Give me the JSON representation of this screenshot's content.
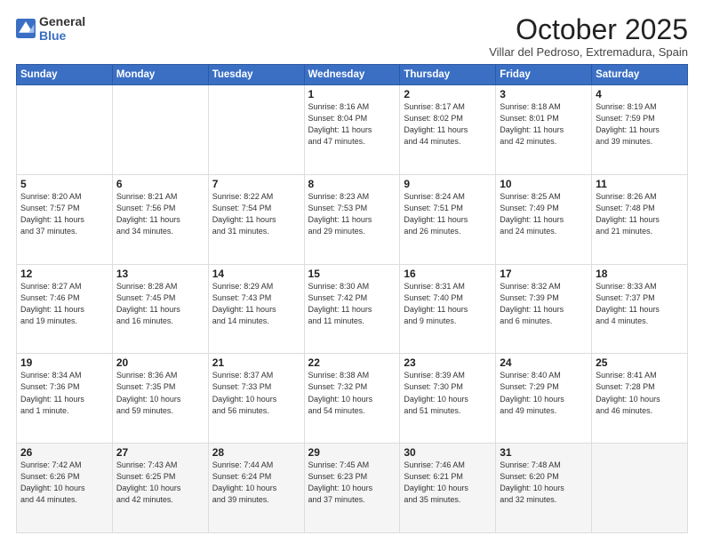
{
  "header": {
    "logo_general": "General",
    "logo_blue": "Blue",
    "month": "October 2025",
    "subtitle": "Villar del Pedroso, Extremadura, Spain"
  },
  "weekdays": [
    "Sunday",
    "Monday",
    "Tuesday",
    "Wednesday",
    "Thursday",
    "Friday",
    "Saturday"
  ],
  "weeks": [
    [
      {
        "day": "",
        "info": ""
      },
      {
        "day": "",
        "info": ""
      },
      {
        "day": "",
        "info": ""
      },
      {
        "day": "1",
        "info": "Sunrise: 8:16 AM\nSunset: 8:04 PM\nDaylight: 11 hours\nand 47 minutes."
      },
      {
        "day": "2",
        "info": "Sunrise: 8:17 AM\nSunset: 8:02 PM\nDaylight: 11 hours\nand 44 minutes."
      },
      {
        "day": "3",
        "info": "Sunrise: 8:18 AM\nSunset: 8:01 PM\nDaylight: 11 hours\nand 42 minutes."
      },
      {
        "day": "4",
        "info": "Sunrise: 8:19 AM\nSunset: 7:59 PM\nDaylight: 11 hours\nand 39 minutes."
      }
    ],
    [
      {
        "day": "5",
        "info": "Sunrise: 8:20 AM\nSunset: 7:57 PM\nDaylight: 11 hours\nand 37 minutes."
      },
      {
        "day": "6",
        "info": "Sunrise: 8:21 AM\nSunset: 7:56 PM\nDaylight: 11 hours\nand 34 minutes."
      },
      {
        "day": "7",
        "info": "Sunrise: 8:22 AM\nSunset: 7:54 PM\nDaylight: 11 hours\nand 31 minutes."
      },
      {
        "day": "8",
        "info": "Sunrise: 8:23 AM\nSunset: 7:53 PM\nDaylight: 11 hours\nand 29 minutes."
      },
      {
        "day": "9",
        "info": "Sunrise: 8:24 AM\nSunset: 7:51 PM\nDaylight: 11 hours\nand 26 minutes."
      },
      {
        "day": "10",
        "info": "Sunrise: 8:25 AM\nSunset: 7:49 PM\nDaylight: 11 hours\nand 24 minutes."
      },
      {
        "day": "11",
        "info": "Sunrise: 8:26 AM\nSunset: 7:48 PM\nDaylight: 11 hours\nand 21 minutes."
      }
    ],
    [
      {
        "day": "12",
        "info": "Sunrise: 8:27 AM\nSunset: 7:46 PM\nDaylight: 11 hours\nand 19 minutes."
      },
      {
        "day": "13",
        "info": "Sunrise: 8:28 AM\nSunset: 7:45 PM\nDaylight: 11 hours\nand 16 minutes."
      },
      {
        "day": "14",
        "info": "Sunrise: 8:29 AM\nSunset: 7:43 PM\nDaylight: 11 hours\nand 14 minutes."
      },
      {
        "day": "15",
        "info": "Sunrise: 8:30 AM\nSunset: 7:42 PM\nDaylight: 11 hours\nand 11 minutes."
      },
      {
        "day": "16",
        "info": "Sunrise: 8:31 AM\nSunset: 7:40 PM\nDaylight: 11 hours\nand 9 minutes."
      },
      {
        "day": "17",
        "info": "Sunrise: 8:32 AM\nSunset: 7:39 PM\nDaylight: 11 hours\nand 6 minutes."
      },
      {
        "day": "18",
        "info": "Sunrise: 8:33 AM\nSunset: 7:37 PM\nDaylight: 11 hours\nand 4 minutes."
      }
    ],
    [
      {
        "day": "19",
        "info": "Sunrise: 8:34 AM\nSunset: 7:36 PM\nDaylight: 11 hours\nand 1 minute."
      },
      {
        "day": "20",
        "info": "Sunrise: 8:36 AM\nSunset: 7:35 PM\nDaylight: 10 hours\nand 59 minutes."
      },
      {
        "day": "21",
        "info": "Sunrise: 8:37 AM\nSunset: 7:33 PM\nDaylight: 10 hours\nand 56 minutes."
      },
      {
        "day": "22",
        "info": "Sunrise: 8:38 AM\nSunset: 7:32 PM\nDaylight: 10 hours\nand 54 minutes."
      },
      {
        "day": "23",
        "info": "Sunrise: 8:39 AM\nSunset: 7:30 PM\nDaylight: 10 hours\nand 51 minutes."
      },
      {
        "day": "24",
        "info": "Sunrise: 8:40 AM\nSunset: 7:29 PM\nDaylight: 10 hours\nand 49 minutes."
      },
      {
        "day": "25",
        "info": "Sunrise: 8:41 AM\nSunset: 7:28 PM\nDaylight: 10 hours\nand 46 minutes."
      }
    ],
    [
      {
        "day": "26",
        "info": "Sunrise: 7:42 AM\nSunset: 6:26 PM\nDaylight: 10 hours\nand 44 minutes."
      },
      {
        "day": "27",
        "info": "Sunrise: 7:43 AM\nSunset: 6:25 PM\nDaylight: 10 hours\nand 42 minutes."
      },
      {
        "day": "28",
        "info": "Sunrise: 7:44 AM\nSunset: 6:24 PM\nDaylight: 10 hours\nand 39 minutes."
      },
      {
        "day": "29",
        "info": "Sunrise: 7:45 AM\nSunset: 6:23 PM\nDaylight: 10 hours\nand 37 minutes."
      },
      {
        "day": "30",
        "info": "Sunrise: 7:46 AM\nSunset: 6:21 PM\nDaylight: 10 hours\nand 35 minutes."
      },
      {
        "day": "31",
        "info": "Sunrise: 7:48 AM\nSunset: 6:20 PM\nDaylight: 10 hours\nand 32 minutes."
      },
      {
        "day": "",
        "info": ""
      }
    ]
  ]
}
